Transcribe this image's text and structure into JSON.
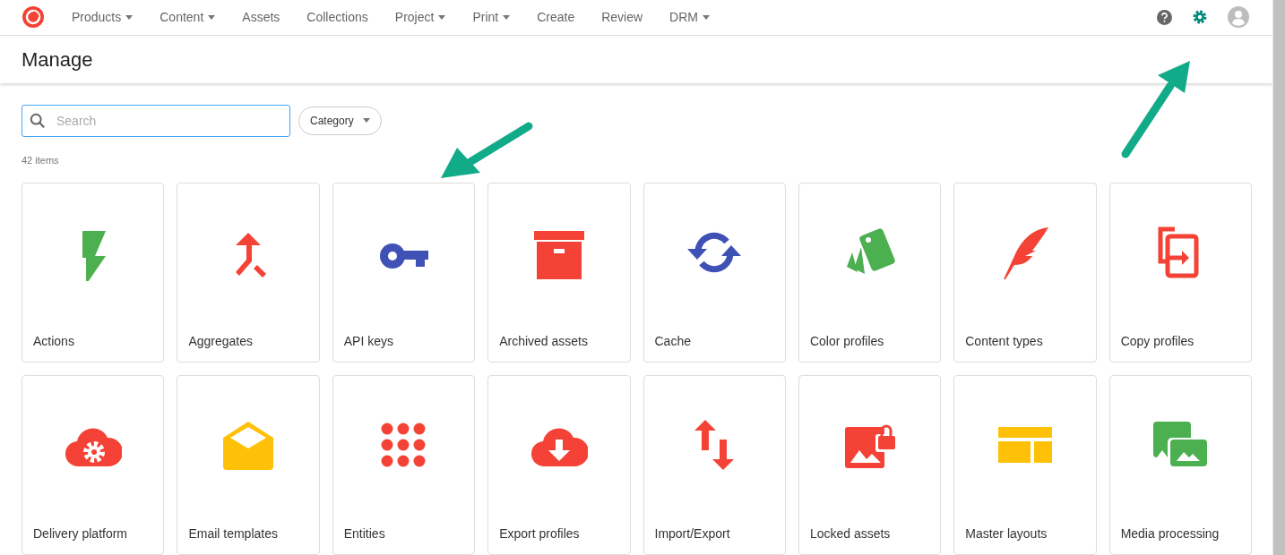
{
  "nav": {
    "items": [
      {
        "label": "Products",
        "dropdown": true
      },
      {
        "label": "Content",
        "dropdown": true
      },
      {
        "label": "Assets",
        "dropdown": false
      },
      {
        "label": "Collections",
        "dropdown": false
      },
      {
        "label": "Project",
        "dropdown": true
      },
      {
        "label": "Print",
        "dropdown": true
      },
      {
        "label": "Create",
        "dropdown": false
      },
      {
        "label": "Review",
        "dropdown": false
      },
      {
        "label": "DRM",
        "dropdown": true
      }
    ]
  },
  "page": {
    "title": "Manage"
  },
  "search": {
    "placeholder": "Search"
  },
  "category_filter": {
    "label": "Category"
  },
  "item_count": "42 items",
  "tiles": [
    {
      "label": "Actions",
      "kind": "bolt",
      "color": "#4caf50"
    },
    {
      "label": "Aggregates",
      "kind": "merge",
      "color": "#f44336"
    },
    {
      "label": "API keys",
      "kind": "key",
      "color": "#3f51b5"
    },
    {
      "label": "Archived assets",
      "kind": "archive",
      "color": "#f44336"
    },
    {
      "label": "Cache",
      "kind": "sync",
      "color": "#3f51b5"
    },
    {
      "label": "Color profiles",
      "kind": "swatches",
      "color": "#4caf50"
    },
    {
      "label": "Content types",
      "kind": "feather",
      "color": "#f44336"
    },
    {
      "label": "Copy profiles",
      "kind": "copy",
      "color": "#f44336"
    },
    {
      "label": "Delivery platform",
      "kind": "cloud-gear",
      "color": "#f44336"
    },
    {
      "label": "Email templates",
      "kind": "envelope",
      "color": "#ffc107"
    },
    {
      "label": "Entities",
      "kind": "dots",
      "color": "#f44336"
    },
    {
      "label": "Export profiles",
      "kind": "cloud-download",
      "color": "#f44336"
    },
    {
      "label": "Import/Export",
      "kind": "updown",
      "color": "#f44336"
    },
    {
      "label": "Locked assets",
      "kind": "image-lock",
      "color": "#f44336"
    },
    {
      "label": "Master layouts",
      "kind": "layout",
      "color": "#ffc107"
    },
    {
      "label": "Media processing",
      "kind": "images",
      "color": "#4caf50"
    }
  ]
}
